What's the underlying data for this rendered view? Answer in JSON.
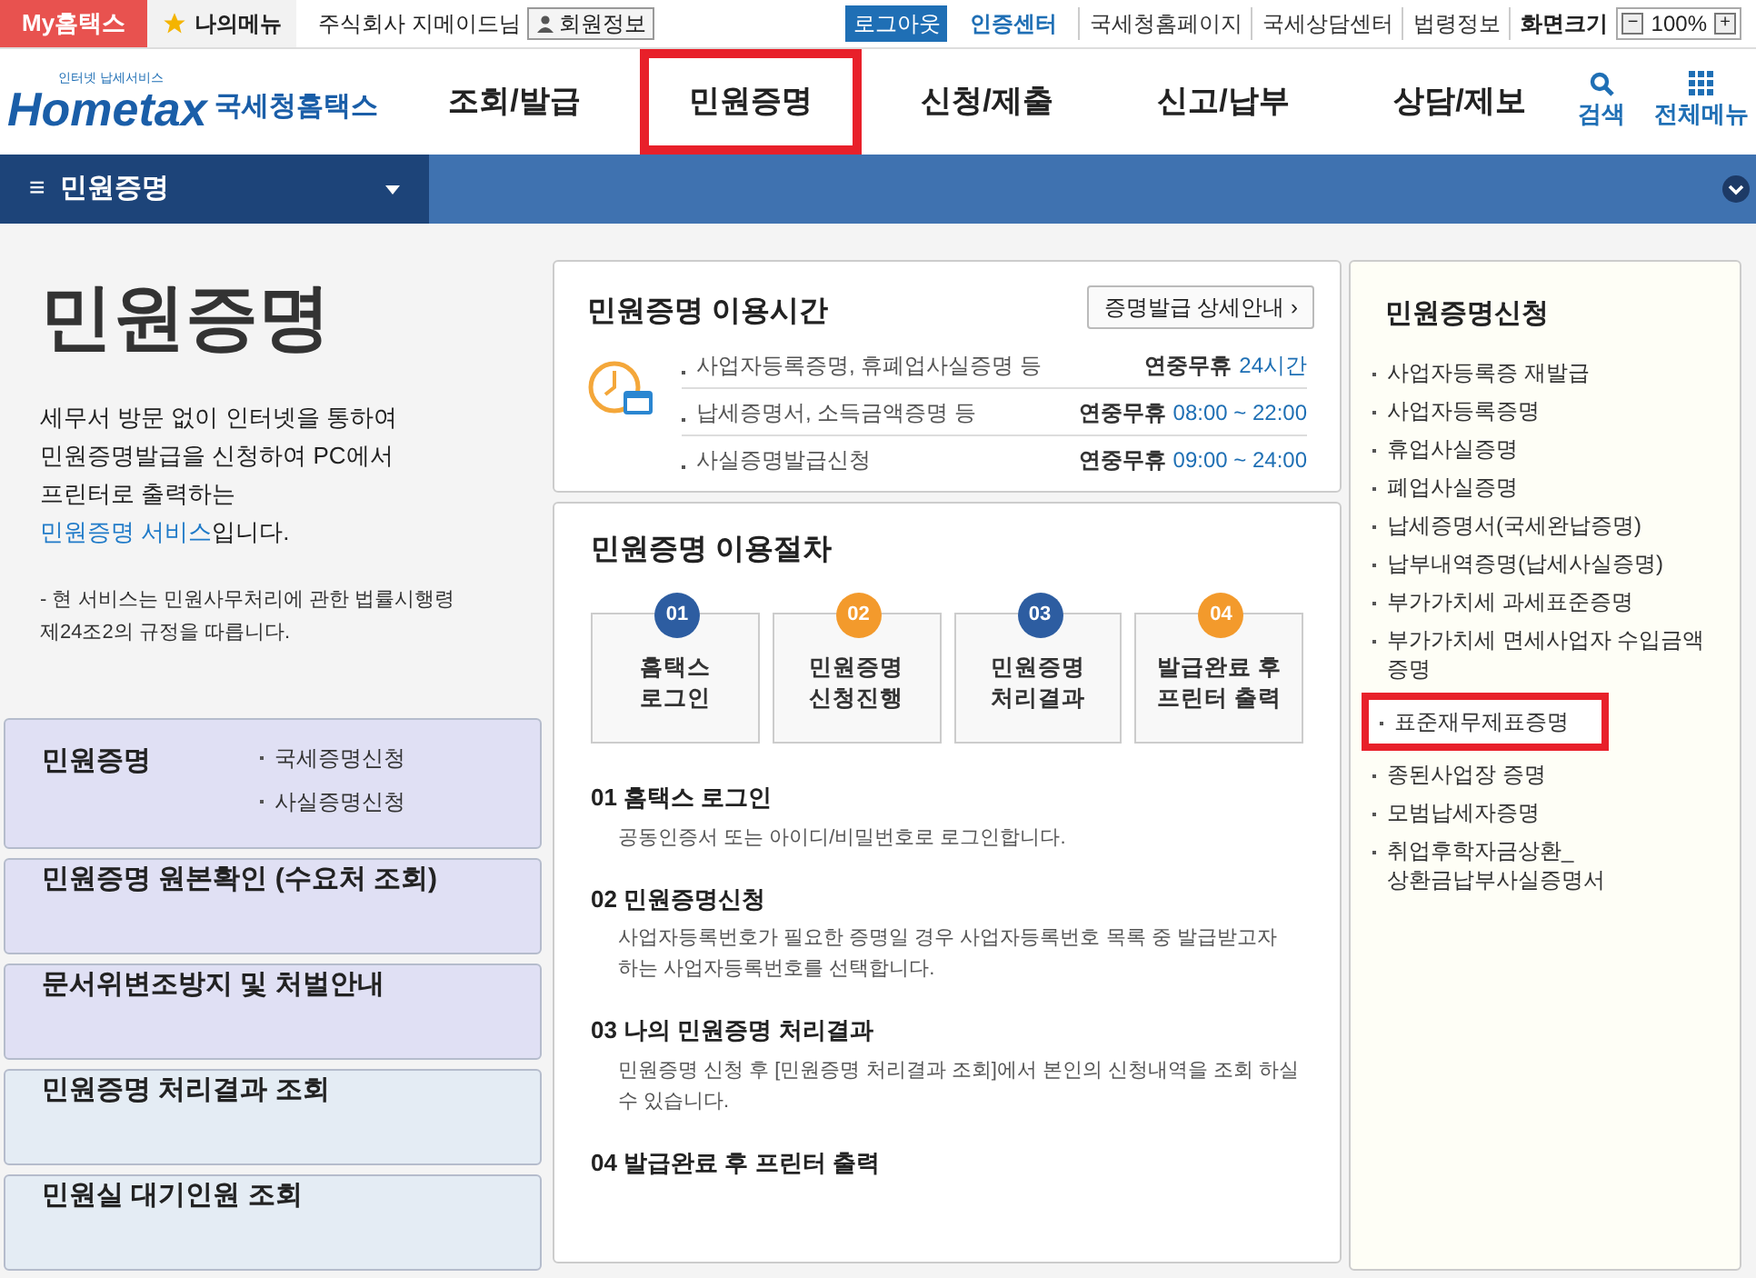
{
  "top_bar": {
    "my_hometax": "My홈택스",
    "my_menu": "나의메뉴",
    "user": "주식회사 지메이드님",
    "member_info": "회원정보",
    "logout": "로그아웃",
    "cert_center": "인증센터",
    "links": [
      "국세청홈페이지",
      "국세상담센터",
      "법령정보"
    ],
    "zoom_label": "화면크기",
    "zoom_minus": "−",
    "zoom_value": "100%",
    "zoom_plus": "+"
  },
  "header": {
    "logo_small": "인터넷 납세서비스",
    "logo_main": "Hometax",
    "logo_name": "국세청홈택스",
    "nav": [
      {
        "label": "조회/발급",
        "selected": false
      },
      {
        "label": "민원증명",
        "selected": true
      },
      {
        "label": "신청/제출",
        "selected": false
      },
      {
        "label": "신고/납부",
        "selected": false
      },
      {
        "label": "상담/제보",
        "selected": false
      }
    ],
    "search": "검색",
    "all_menu": "전체메뉴"
  },
  "breadcrumb": {
    "menu_glyph": "≡",
    "label": "민원증명"
  },
  "intro": {
    "title": "민원증명",
    "body_before": "세무서 방문 없이 인터넷을 통하여 민원증명발급을 신청하여 PC에서 프린터로 출력하는 ",
    "body_link": "민원증명 서비스",
    "body_after": "입니다.",
    "note": "- 현 서비스는 민원사무처리에 관한 법률시행령 제24조2의 규정을 따릅니다."
  },
  "left_menu": [
    {
      "label": "민원증명",
      "sub": [
        "국세증명신청",
        "사실증명신청"
      ],
      "color": "#e0e0f4"
    },
    {
      "label": "민원증명 원본확인 (수요처 조회)",
      "color": "#e0e0f4"
    },
    {
      "label": "문서위변조방지 및 처벌안내",
      "color": "#e0e0f4"
    },
    {
      "label": "민원증명 처리결과 조회",
      "color": "#e4ecf4"
    },
    {
      "label": "민원실 대기인원 조회",
      "color": "#e4ecf4"
    }
  ],
  "hours": {
    "title": "민원증명 이용시간",
    "detail_button": "증명발급 상세안내 ›",
    "rows": [
      {
        "item": "사업자등록증명, 휴폐업사실증명 등",
        "prefix": "연중무휴",
        "time": "24시간"
      },
      {
        "item": "납세증명서, 소득금액증명 등",
        "prefix": "연중무휴",
        "time": "08:00 ~ 22:00"
      },
      {
        "item": "사실증명발급신청",
        "prefix": "연중무휴",
        "time": "09:00 ~ 24:00"
      }
    ]
  },
  "procedure": {
    "title": "민원증명 이용절차",
    "steps": [
      {
        "num": "01",
        "label": "홈택스 로그인",
        "color": "#2d5da1"
      },
      {
        "num": "02",
        "label": "민원증명 신청진행",
        "color": "#f39a2c"
      },
      {
        "num": "03",
        "label": "민원증명 처리결과",
        "color": "#2d5da1"
      },
      {
        "num": "04",
        "label": "발급완료 후 프린터 출력",
        "color": "#f39a2c"
      }
    ],
    "details": [
      {
        "heading": "01 홈택스 로그인",
        "text": "공동인증서 또는 아이디/비밀번호로 로그인합니다."
      },
      {
        "heading": "02 민원증명신청",
        "text": "사업자등록번호가 필요한 증명일 경우 사업자등록번호 목록 중 발급받고자 하는 사업자등록번호를 선택합니다."
      },
      {
        "heading": "03 나의 민원증명 처리결과",
        "text": "민원증명 신청 후 [민원증명 처리결과 조회]에서 본인의 신청내역을 조회 하실 수 있습니다."
      },
      {
        "heading": "04 발급완료 후 프린터 출력"
      }
    ]
  },
  "apply": {
    "title": "민원증명신청",
    "items": [
      {
        "label": "사업자등록증 재발급",
        "selected": false
      },
      {
        "label": "사업자등록증명",
        "selected": false
      },
      {
        "label": "휴업사실증명",
        "selected": false
      },
      {
        "label": "폐업사실증명",
        "selected": false
      },
      {
        "label": "납세증명서(국세완납증명)",
        "selected": false
      },
      {
        "label": "납부내역증명(납세사실증명)",
        "selected": false
      },
      {
        "label": "부가가치세 과세표준증명",
        "selected": false
      },
      {
        "label": "부가가치세 면세사업자 수입금액 증명",
        "selected": false
      },
      {
        "label": "표준재무제표증명",
        "selected": true
      },
      {
        "label": "종된사업장 증명",
        "selected": false
      },
      {
        "label": "모범납세자증명",
        "selected": false
      },
      {
        "label": "취업후학자금상환_상환금납부사실증명서",
        "selected": false
      }
    ]
  }
}
